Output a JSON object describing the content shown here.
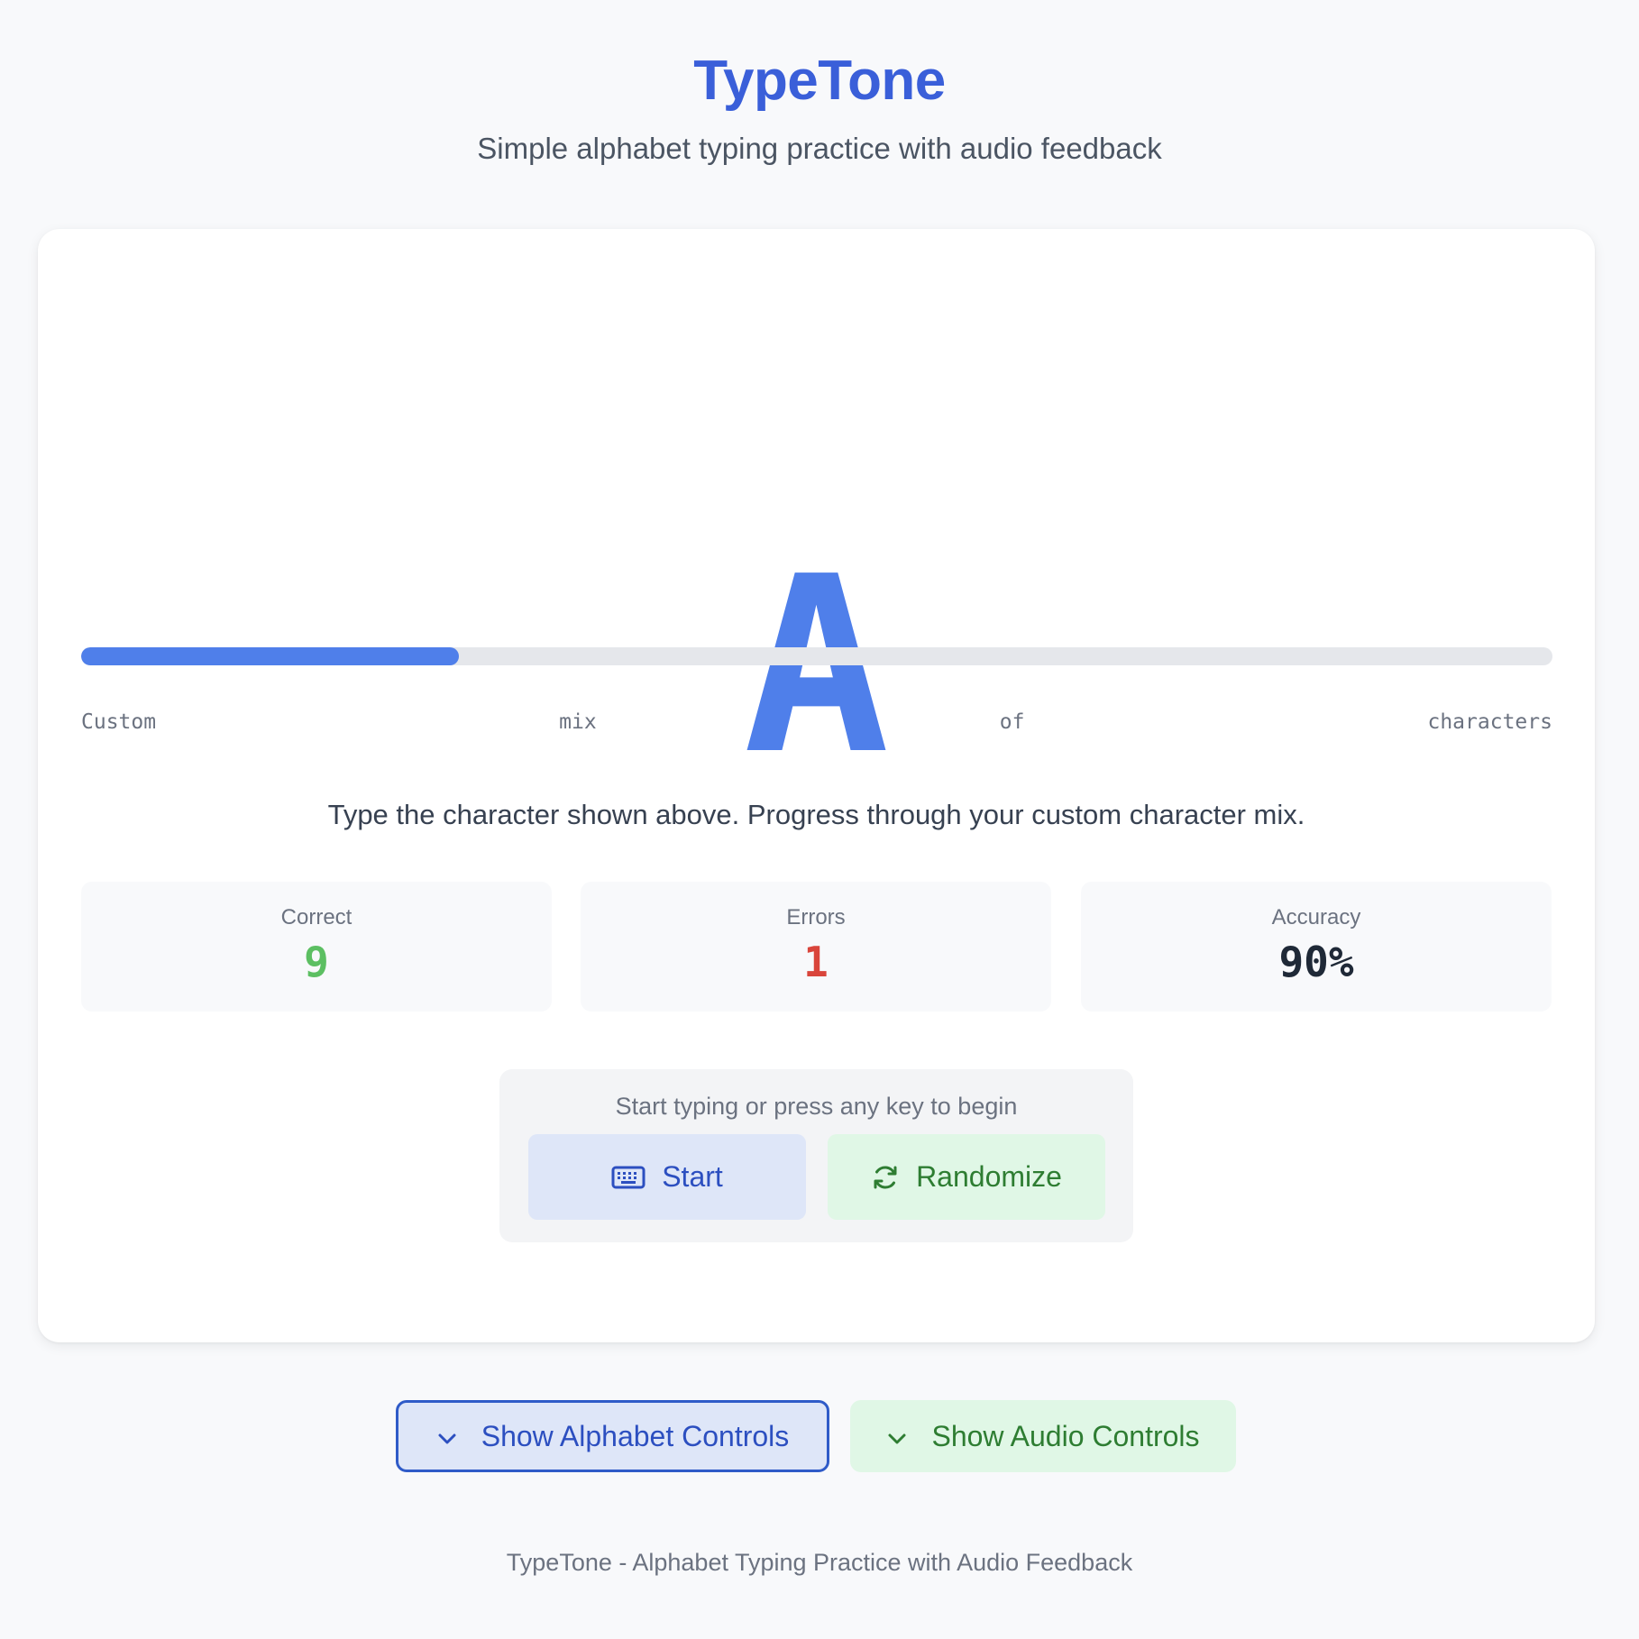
{
  "header": {
    "title": "TypeTone",
    "subtitle": "Simple alphabet typing practice with audio feedback"
  },
  "practice": {
    "current_char": "A",
    "progress_fraction": 0.257,
    "progress_labels": [
      "Custom",
      "mix",
      "of",
      "characters"
    ],
    "instruction": "Type the character shown above. Progress through your custom character mix."
  },
  "stats": [
    {
      "label": "Correct",
      "value": "9",
      "color": "#5cbf62"
    },
    {
      "label": "Errors",
      "value": "1",
      "color": "#d9453b"
    },
    {
      "label": "Accuracy",
      "value": "90%",
      "color": "#1f2937"
    }
  ],
  "start_panel": {
    "hint": "Start typing or press any key to begin",
    "start_label": "Start",
    "start_icon": "keyboard-icon",
    "randomize_label": "Randomize",
    "randomize_icon": "refresh-icon"
  },
  "toggles": {
    "alphabet_label": "Show Alphabet Controls",
    "audio_label": "Show Audio Controls",
    "icon": "chevron-down-icon"
  },
  "colors": {
    "accent": "#3a5fd9",
    "char": "#4f7fea",
    "green": "#2e7d32"
  },
  "footer": {
    "text": "TypeTone - Alphabet Typing Practice with Audio Feedback"
  }
}
